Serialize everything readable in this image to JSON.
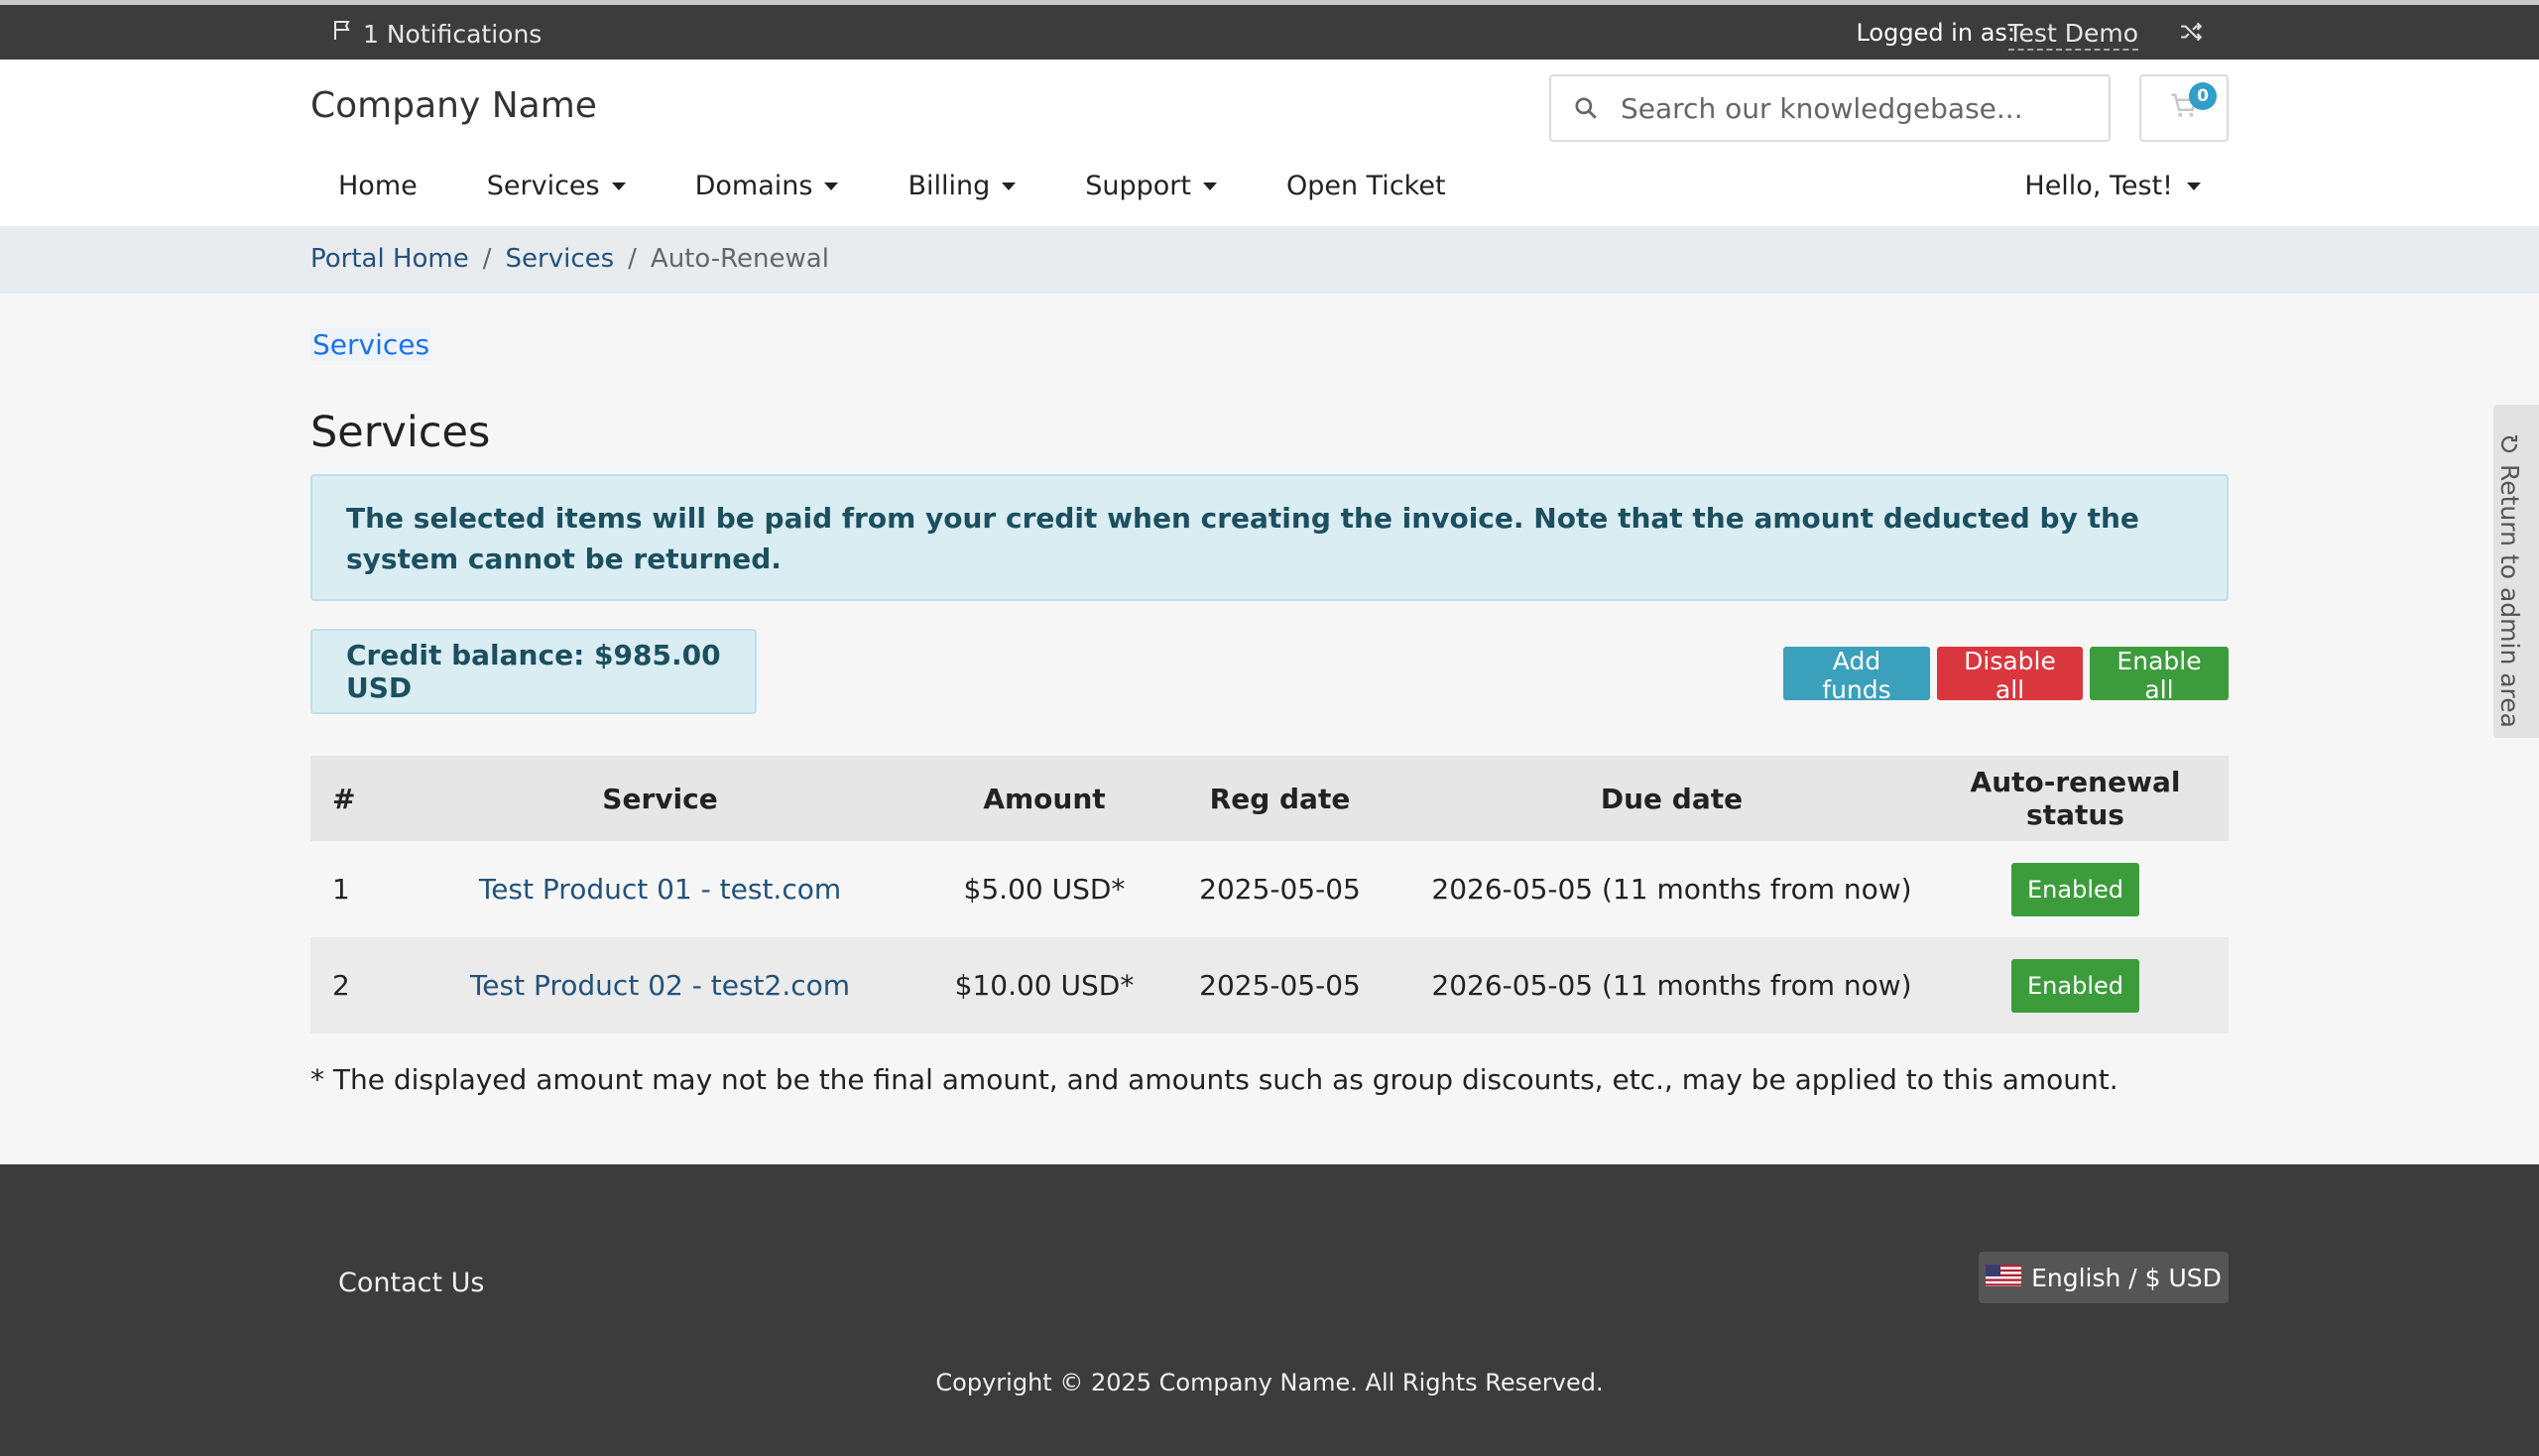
{
  "topbar": {
    "notifications": "1 Notifications",
    "logged_in_label": "Logged in as:",
    "user_name": "Test Demo"
  },
  "header": {
    "brand": "Company Name",
    "search_placeholder": "Search our knowledgebase...",
    "cart_count": "0"
  },
  "nav": {
    "items": [
      "Home",
      "Services",
      "Domains",
      "Billing",
      "Support",
      "Open Ticket"
    ],
    "user_menu": "Hello, Test!"
  },
  "breadcrumb": {
    "home": "Portal Home",
    "services": "Services",
    "current": "Auto-Renewal"
  },
  "main": {
    "sub_link": "Services",
    "title": "Services",
    "alert": "The selected items will be paid from your credit when creating the invoice. Note that the amount deducted by the system cannot be returned.",
    "credit_balance": "Credit balance: $985.00 USD",
    "buttons": {
      "add_funds": "Add funds",
      "disable_all": "Disable all",
      "enable_all": "Enable all"
    },
    "table": {
      "headers": [
        "#",
        "Service",
        "Amount",
        "Reg date",
        "Due date",
        "Auto-renewal status"
      ],
      "rows": [
        {
          "num": "1",
          "service": "Test Product 01 - test.com",
          "amount": "$5.00 USD*",
          "reg_date": "2025-05-05",
          "due_date": "2026-05-05 (11 months from now)",
          "status": "Enabled"
        },
        {
          "num": "2",
          "service": "Test Product 02 - test2.com",
          "amount": "$10.00 USD*",
          "reg_date": "2025-05-05",
          "due_date": "2026-05-05 (11 months from now)",
          "status": "Enabled"
        }
      ]
    },
    "note": "* The displayed amount may not be the final amount, and amounts such as group discounts, etc., may be applied to this amount."
  },
  "footer": {
    "contact": "Contact Us",
    "language": "English / $ USD",
    "copyright": "Copyright © 2025 Company Name. All Rights Reserved."
  },
  "sidetab": {
    "label": "Return to admin area"
  },
  "colors": {
    "topbar_bg": "#3c3c3c",
    "link": "#23527c",
    "info": "#3ba0bb",
    "danger": "#d9363e",
    "success": "#3c9c3c",
    "alert_bg": "#d9edf3"
  }
}
